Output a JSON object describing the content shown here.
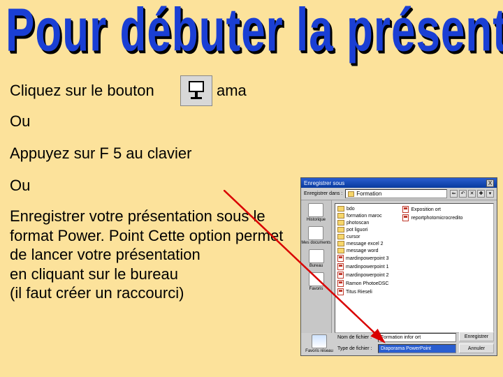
{
  "title": "Pour débuter la présentation",
  "lines": {
    "l1a": "Cliquez sur le bouton ",
    "l1b": "ama",
    "l2": "Ou",
    "l3": "Appuyez sur F 5 au clavier",
    "l4": "Ou"
  },
  "paragraph": "Enregistrer votre présentation sous le format Power. Point Cette option permet de lancer votre présentation\n en cliquant sur le bureau\n(il faut créer un raccourci)",
  "dialog": {
    "title": "Enregistrer sous",
    "close": "X",
    "toolbar": {
      "label": "Enregistrer dans :",
      "folder": "Formation"
    },
    "sidebar": {
      "s1": "Historique",
      "s2": "Mes documents",
      "s3": "Bureau",
      "s4": "Favoris",
      "s5": "Favoris réseau"
    },
    "files_left": [
      "bdo",
      "formation maroc",
      "photoscan",
      "pot liguori",
      "cursor",
      "message excel 2",
      "message word",
      "mardinpowerpoint 3",
      "mardinpowerpoint 1",
      "mardinpowerpoint 2",
      "Ramon PhotoeDSC",
      "Titus Rieseli"
    ],
    "files_right": [
      "Exposition ort",
      "reportphotomicrocredito"
    ],
    "bottom": {
      "name_label": "Nom de fichier :",
      "name_value": "Formation infor ort",
      "type_label": "Type de fichier :",
      "type_value": "Diaporama PowerPoint",
      "save": "Enregistrer",
      "cancel": "Annuler"
    }
  }
}
